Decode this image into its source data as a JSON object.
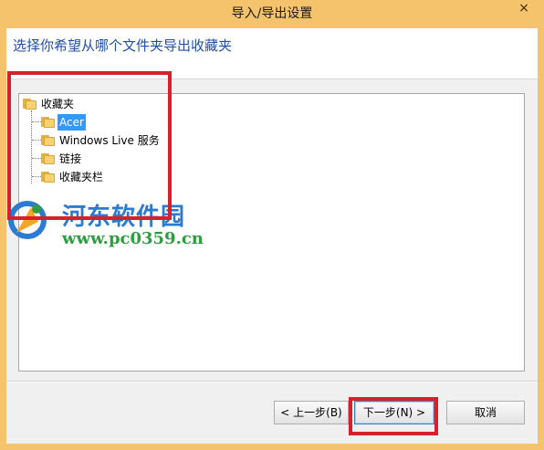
{
  "window": {
    "title": "导入/导出设置",
    "close_glyph": "×"
  },
  "header": {
    "instruction": "选择你希望从哪个文件夹导出收藏夹"
  },
  "tree": {
    "root": {
      "label": "收藏夹",
      "icon": "folder-icon"
    },
    "children": [
      {
        "label": "Acer",
        "icon": "folder-icon",
        "selected": true
      },
      {
        "label": "Windows Live 服务",
        "icon": "folder-icon",
        "selected": false
      },
      {
        "label": "链接",
        "icon": "folder-icon",
        "selected": false
      },
      {
        "label": "收藏夹栏",
        "icon": "folder-icon",
        "selected": false
      }
    ]
  },
  "buttons": {
    "back": "< 上一步(B)",
    "next": "下一步(N) >",
    "cancel": "取消"
  },
  "watermark": {
    "site_name": "河东软件园",
    "url": "www.pc0359.cn"
  },
  "colors": {
    "frame": "#f5c36b",
    "header_text": "#1f4fa6",
    "selection": "#3399ff",
    "annotation": "#d8202c",
    "watermark_blue": "#2a7bd1",
    "watermark_green": "#2e9c3f"
  }
}
